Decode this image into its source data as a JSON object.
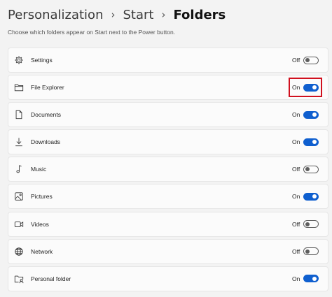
{
  "breadcrumb": {
    "items": [
      "Personalization",
      "Start",
      "Folders"
    ],
    "separator": "›"
  },
  "description": "Choose which folders appear on Start next to the Power button.",
  "folders": [
    {
      "label": "Settings",
      "state": "Off",
      "on": false,
      "icon": "gear-icon"
    },
    {
      "label": "File Explorer",
      "state": "On",
      "on": true,
      "icon": "folder-icon",
      "highlighted": true
    },
    {
      "label": "Documents",
      "state": "On",
      "on": true,
      "icon": "document-icon"
    },
    {
      "label": "Downloads",
      "state": "On",
      "on": true,
      "icon": "download-icon"
    },
    {
      "label": "Music",
      "state": "Off",
      "on": false,
      "icon": "music-icon"
    },
    {
      "label": "Pictures",
      "state": "On",
      "on": true,
      "icon": "picture-icon"
    },
    {
      "label": "Videos",
      "state": "Off",
      "on": false,
      "icon": "video-icon"
    },
    {
      "label": "Network",
      "state": "Off",
      "on": false,
      "icon": "network-icon"
    },
    {
      "label": "Personal folder",
      "state": "On",
      "on": true,
      "icon": "personal-folder-icon"
    }
  ],
  "colors": {
    "accent": "#0f5fcf",
    "highlight": "#d0101e",
    "background": "#f3f3f3",
    "card": "#fbfbfb"
  }
}
